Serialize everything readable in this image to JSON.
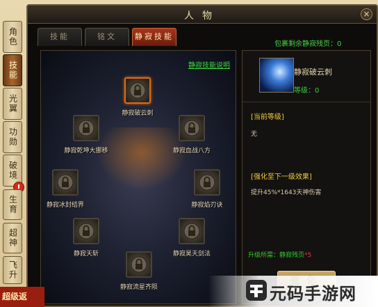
{
  "window": {
    "title": "人物",
    "close_glyph": "×"
  },
  "side_tabs": [
    {
      "label": "角色",
      "active": false
    },
    {
      "label": "技能",
      "active": true
    },
    {
      "label": "光翼",
      "active": false
    },
    {
      "label": "功勋",
      "active": false
    },
    {
      "label": "破境",
      "active": false
    },
    {
      "label": "生育",
      "active": false
    },
    {
      "label": "超神",
      "active": false
    },
    {
      "label": "飞升",
      "active": false
    }
  ],
  "alert_badge": "!",
  "top_tabs": [
    {
      "label": "技能",
      "active": false
    },
    {
      "label": "铭文",
      "active": false
    },
    {
      "label": "静寂技能",
      "active": true
    }
  ],
  "spare_pages": "包裹剩余静寂残页：0",
  "tree": {
    "help_link": "静寂技能说明",
    "nodes": [
      {
        "label": "静寂破云刺",
        "selected": true
      },
      {
        "label": "静寂乾坤大挪移",
        "selected": false
      },
      {
        "label": "静寂血战八方",
        "selected": false
      },
      {
        "label": "静寂冰封结界",
        "selected": false
      },
      {
        "label": "静寂焰刃诀",
        "selected": false
      },
      {
        "label": "静寂天斩",
        "selected": false
      },
      {
        "label": "静寂昊天剑法",
        "selected": false
      },
      {
        "label": "静寂流星齐陨",
        "selected": false
      }
    ]
  },
  "info": {
    "skill_name": "静寂破云刺",
    "level_label": "等级：0",
    "current_level_header": "[当前等级]",
    "current_level_text": "无",
    "next_header": "[强化至下一级效果]",
    "next_text": "提升45%*1643天神伤害",
    "req_key": "升级所需：静寂残页",
    "req_val": "*5",
    "strengthen_label": "强化"
  },
  "bottom_banner": "超级返",
  "watermark": "元码手游网",
  "colors": {
    "accent": "#e06a14",
    "green": "#3cd83c",
    "gold": "#f0cc3a",
    "tab_active": "#a8341c"
  }
}
